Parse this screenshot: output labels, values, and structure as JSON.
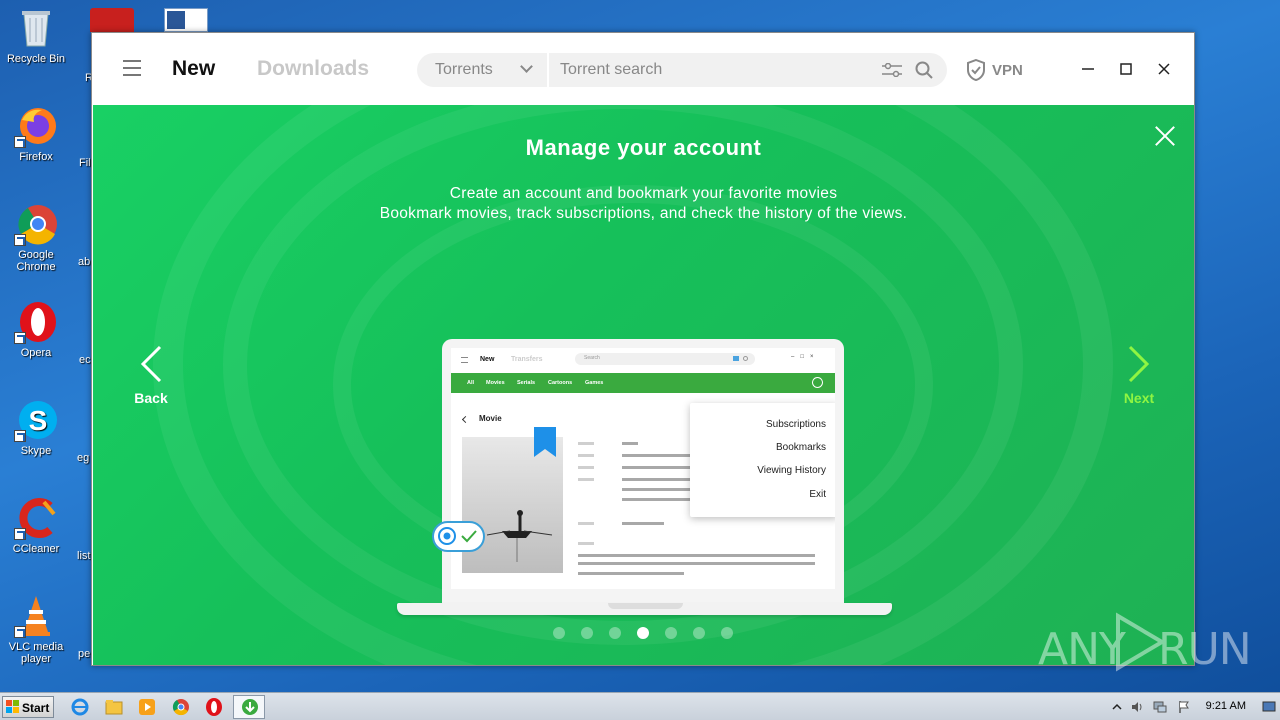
{
  "desktop": {
    "icons": [
      {
        "label": "Recycle Bin"
      },
      {
        "label": "Firefox"
      },
      {
        "label": "Google Chrome"
      },
      {
        "label": "Opera"
      },
      {
        "label": "Skype"
      },
      {
        "label": "CCleaner"
      },
      {
        "label": "VLC media player"
      }
    ],
    "partial_labels": [
      "R",
      "Fil",
      "ab",
      "ec",
      "eg",
      "list",
      "pe"
    ]
  },
  "app": {
    "tabs": {
      "new": "New",
      "downloads": "Downloads"
    },
    "search": {
      "category": "Torrents",
      "placeholder": "Torrent search"
    },
    "vpn_label": "VPN",
    "onboarding": {
      "title": "Manage your account",
      "line1": "Create an account and bookmark your favorite movies",
      "line2": "Bookmark movies, track subscriptions, and check the history of the views.",
      "back_label": "Back",
      "next_label": "Next",
      "current_slide": 4,
      "total_slides": 7
    },
    "illustration": {
      "mini_new": "New",
      "mini_transfers": "Transfers",
      "mini_search": "Search",
      "categories": [
        "All",
        "Movies",
        "Serials",
        "Cartoons",
        "Games"
      ],
      "movie_label": "Movie",
      "menu": [
        "Subscriptions",
        "Bookmarks",
        "Viewing History",
        "Exit"
      ]
    }
  },
  "taskbar": {
    "start_label": "Start",
    "time": "9:21 AM"
  },
  "watermark": {
    "left": "ANY",
    "right": "RUN"
  },
  "colors": {
    "accent_green": "#19d064",
    "next_green": "#8ff542"
  }
}
